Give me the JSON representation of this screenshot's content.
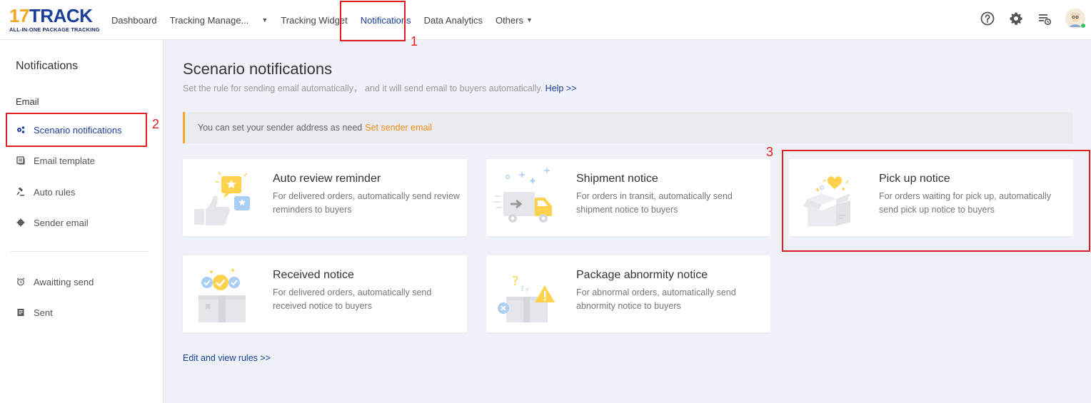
{
  "logo": {
    "brand_num": "17",
    "brand_text": "TRACK",
    "tagline": "ALL-IN-ONE PACKAGE TRACKING"
  },
  "nav": {
    "items": [
      {
        "label": "Dashboard"
      },
      {
        "label": "Tracking Manage..."
      },
      {
        "label": "Tracking Widget"
      },
      {
        "label": "Notifications"
      },
      {
        "label": "Data Analytics"
      },
      {
        "label": "Others"
      }
    ],
    "active": "Notifications"
  },
  "top_icons": [
    "help-circle-icon",
    "gear-icon",
    "task-list-icon",
    "user-avatar"
  ],
  "sidebar": {
    "title": "Notifications",
    "section": "Email",
    "items": [
      {
        "label": "Scenario notifications",
        "icon": "gears-icon"
      },
      {
        "label": "Email template",
        "icon": "template-icon"
      },
      {
        "label": "Auto rules",
        "icon": "gavel-icon"
      },
      {
        "label": "Sender email",
        "icon": "gear-icon"
      },
      {
        "label": "Awaitting send",
        "icon": "alarm-clock-icon"
      },
      {
        "label": "Sent",
        "icon": "sent-icon"
      }
    ]
  },
  "main": {
    "title": "Scenario notifications",
    "subtitle": "Set the rule for sending email automatically， and it will send email to buyers automatically.",
    "help_link": "Help >>",
    "notice_text": "You can set your sender address as need",
    "notice_link": "Set sender email",
    "cards": [
      {
        "title": "Auto review reminder",
        "desc": "For delivered orders, automatically send review reminders to buyers"
      },
      {
        "title": "Shipment notice",
        "desc": "For orders in transit, automatically send shipment notice to buyers"
      },
      {
        "title": "Pick up notice",
        "desc": "For orders waiting for pick up, automatically send pick up notice to buyers"
      },
      {
        "title": "Received notice",
        "desc": "For delivered orders, automatically send received notice to buyers"
      },
      {
        "title": "Package abnormity notice",
        "desc": "For abnormal orders, automatically send abnormity notice to buyers"
      }
    ],
    "rules_link": "Edit and view rules >>"
  },
  "annotations": {
    "one": "1",
    "two": "2",
    "three": "3"
  },
  "colors": {
    "brand_blue": "#1b3f9b",
    "accent_orange": "#f5a623",
    "link_orange": "#f08c1c",
    "annotation_red": "#e02020"
  }
}
